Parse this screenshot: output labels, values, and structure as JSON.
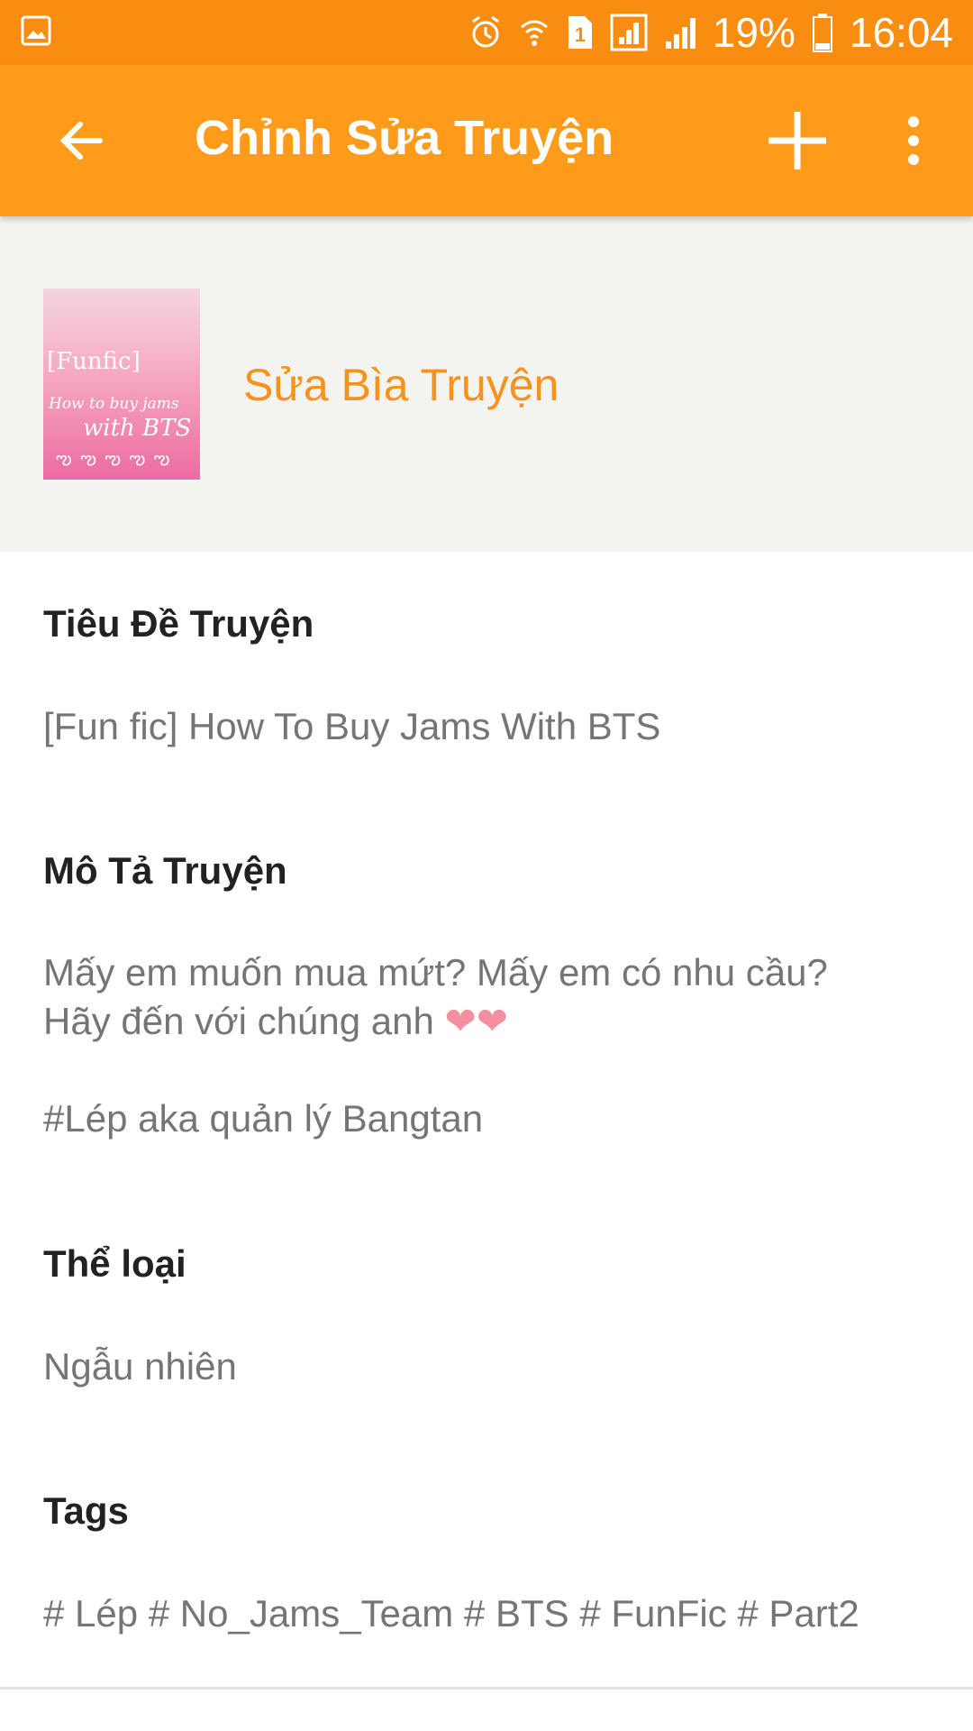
{
  "status_bar": {
    "battery": "19%",
    "time": "16:04",
    "sim_badge": "1",
    "icons": [
      "gallery-notification-icon",
      "alarm-icon",
      "wifi-icon",
      "sim-icon",
      "signal-icon",
      "signal-icon",
      "battery-icon"
    ]
  },
  "app_bar": {
    "title": "Chỉnh Sửa Truyện",
    "back_icon": "arrow-back-icon",
    "add_icon": "plus-icon",
    "more_icon": "more-vert-icon"
  },
  "cover": {
    "thumb_text": [
      "[Funfic]",
      "How to buy jams",
      "with BTS",
      "ఌ ఌ ఌ ఌ ఌ"
    ],
    "edit_label": "Sửa Bìa Truyện"
  },
  "fields": {
    "title_label": "Tiêu Đề Truyện",
    "title_value": "[Fun fic] How To Buy Jams With BTS",
    "desc_label": "Mô Tả Truyện",
    "desc_line1": "Mấy em muốn mua mứt? Mấy em có nhu cầu?",
    "desc_line2": "Hãy đến với chúng anh",
    "desc_hearts": "❤❤",
    "desc_line3": "#Lép aka quản lý Bangtan",
    "genre_label": "Thể loại",
    "genre_value": "Ngẫu nhiên",
    "tags_label": "Tags",
    "tags_value": "# Lép # No_Jams_Team # BTS # FunFic # Part2"
  },
  "colors": {
    "status_bar": "#f98d12",
    "app_bar": "#fe9b1b",
    "accent": "#f6921e",
    "cover_bg": "#f3f3ef"
  }
}
